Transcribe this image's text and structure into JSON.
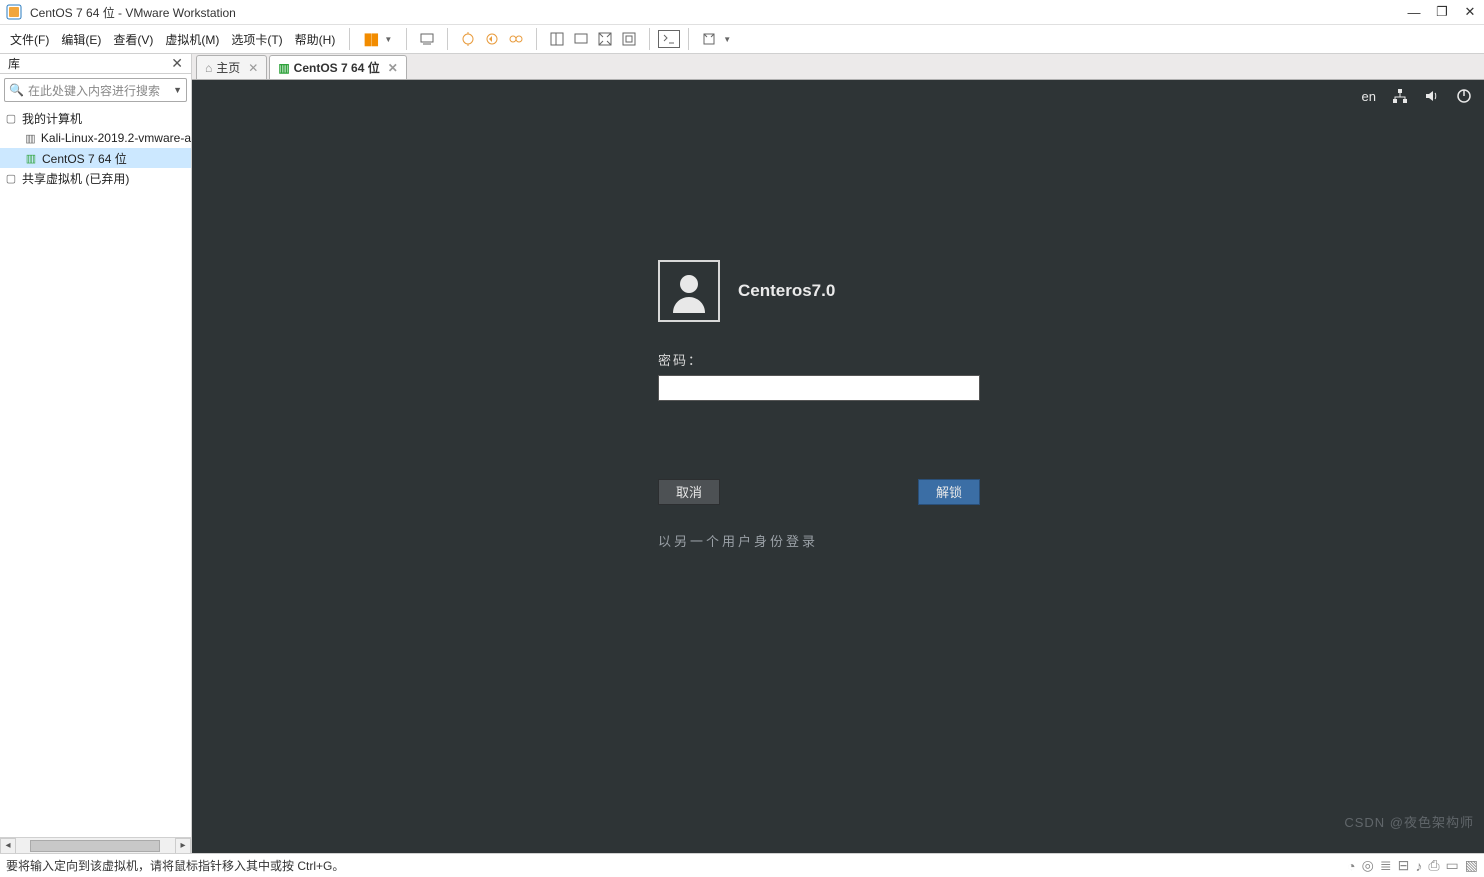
{
  "window": {
    "title": "CentOS 7 64 位 - VMware Workstation",
    "minimize": "—",
    "maximize": "❐",
    "close": "✕"
  },
  "menu": {
    "file": "文件(F)",
    "edit": "编辑(E)",
    "view": "查看(V)",
    "vm": "虚拟机(M)",
    "tabs": "选项卡(T)",
    "help": "帮助(H)"
  },
  "library": {
    "title": "库",
    "close": "✕",
    "search_placeholder": "在此处键入内容进行搜索",
    "nodes": {
      "root": "我的计算机",
      "item1": "Kali-Linux-2019.2-vmware-a",
      "item2": "CentOS 7 64 位",
      "shared": "共享虚拟机 (已弃用)"
    }
  },
  "tabs": {
    "home": "主页",
    "active": "CentOS 7 64 位"
  },
  "guest": {
    "lang": "en",
    "username": "Centeros7.0",
    "password_label": "密码：",
    "cancel": "取消",
    "unlock": "解锁",
    "other_user": "以另一个用户身份登录"
  },
  "statusbar": {
    "text": "要将输入定向到该虚拟机，请将鼠标指针移入其中或按 Ctrl+G。"
  },
  "watermark": "CSDN @夜色架构师"
}
